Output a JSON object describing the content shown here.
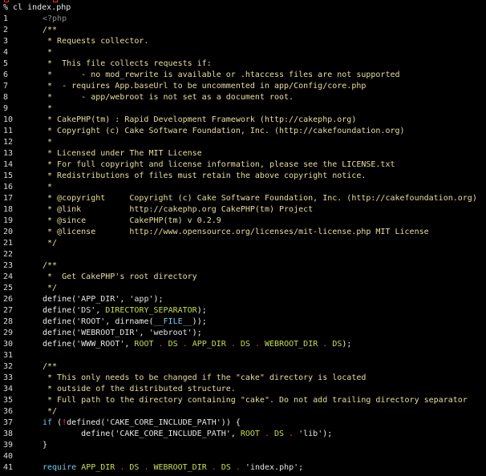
{
  "prompt": "% cl index.php",
  "lines": [
    [
      [
        "t",
        "<?php"
      ]
    ],
    [
      [
        "c",
        "/**"
      ]
    ],
    [
      [
        "c",
        " * Requests collector."
      ]
    ],
    [
      [
        "c",
        " *"
      ]
    ],
    [
      [
        "c",
        " *  This file collects requests if:"
      ]
    ],
    [
      [
        "c",
        " *      - no mod_rewrite is available or .htaccess files are not supported"
      ]
    ],
    [
      [
        "c",
        " *  - requires App.baseUrl to be uncommented in app/Config/core.php"
      ]
    ],
    [
      [
        "c",
        " *      - app/webroot is not set as a document root."
      ]
    ],
    [
      [
        "c",
        " *"
      ]
    ],
    [
      [
        "c",
        " * CakePHP(tm) : Rapid Development Framework (http://cakephp.org)"
      ]
    ],
    [
      [
        "c",
        " * Copyright (c) Cake Software Foundation, Inc. (http://cakefoundation.org)"
      ]
    ],
    [
      [
        "c",
        " *"
      ]
    ],
    [
      [
        "c",
        " * Licensed under The MIT License"
      ]
    ],
    [
      [
        "c",
        " * For full copyright and license information, please see the LICENSE.txt"
      ]
    ],
    [
      [
        "c",
        " * Redistributions of files must retain the above copyright notice."
      ]
    ],
    [
      [
        "c",
        " *"
      ]
    ],
    [
      [
        "c",
        " * @copyright     Copyright (c) Cake Software Foundation, Inc. (http://cakefoundation.org)"
      ]
    ],
    [
      [
        "c",
        " * @link          http://cakephp.org CakePHP(tm) Project"
      ]
    ],
    [
      [
        "c",
        " * @since         CakePHP(tm) v 0.2.9"
      ]
    ],
    [
      [
        "c",
        " * @license       http://www.opensource.org/licenses/mit-license.php MIT License"
      ]
    ],
    [
      [
        "c",
        " */"
      ]
    ],
    [],
    [
      [
        "c",
        "/**"
      ]
    ],
    [
      [
        "c",
        " *  Get CakePHP's root directory"
      ]
    ],
    [
      [
        "c",
        " */"
      ]
    ],
    [
      [
        "f",
        "define("
      ],
      [
        "s",
        "'APP_DIR'"
      ],
      [
        "p",
        ", "
      ],
      [
        "s",
        "'app'"
      ],
      [
        "p",
        ");"
      ]
    ],
    [
      [
        "f",
        "define("
      ],
      [
        "s",
        "'DS'"
      ],
      [
        "p",
        ", "
      ],
      [
        "k",
        "DIRECTORY_SEPARATOR"
      ],
      [
        "p",
        ");"
      ]
    ],
    [
      [
        "f",
        "define("
      ],
      [
        "s",
        "'ROOT'"
      ],
      [
        "p",
        ", dirname("
      ],
      [
        "kw",
        "__FILE__"
      ],
      [
        "p",
        "));"
      ]
    ],
    [
      [
        "f",
        "define("
      ],
      [
        "s",
        "'WEBROOT_DIR'"
      ],
      [
        "p",
        ", "
      ],
      [
        "s",
        "'webroot'"
      ],
      [
        "p",
        ");"
      ]
    ],
    [
      [
        "f",
        "define("
      ],
      [
        "s",
        "'WWW_ROOT'"
      ],
      [
        "p",
        ", "
      ],
      [
        "k",
        "ROOT"
      ],
      [
        "d",
        " . "
      ],
      [
        "k",
        "DS"
      ],
      [
        "d",
        " . "
      ],
      [
        "k",
        "APP_DIR"
      ],
      [
        "d",
        " . "
      ],
      [
        "k",
        "DS"
      ],
      [
        "d",
        " . "
      ],
      [
        "k",
        "WEBROOT_DIR"
      ],
      [
        "d",
        " . "
      ],
      [
        "k",
        "DS"
      ],
      [
        "p",
        ");"
      ]
    ],
    [],
    [
      [
        "c",
        "/**"
      ]
    ],
    [
      [
        "c",
        " * This only needs to be changed if the \"cake\" directory is located"
      ]
    ],
    [
      [
        "c",
        " * outside of the distributed structure."
      ]
    ],
    [
      [
        "c",
        " * Full path to the directory containing \"cake\". Do not add trailing directory separator"
      ]
    ],
    [
      [
        "c",
        " */"
      ]
    ],
    [
      [
        "kw",
        "if"
      ],
      [
        "p",
        " ("
      ],
      [
        "d",
        "!"
      ],
      [
        "f",
        "defined("
      ],
      [
        "s",
        "'CAKE_CORE_INCLUDE_PATH'"
      ],
      [
        "p",
        ")) {"
      ]
    ],
    [
      [
        "f",
        "        define("
      ],
      [
        "s",
        "'CAKE_CORE_INCLUDE_PATH'"
      ],
      [
        "p",
        ", "
      ],
      [
        "k",
        "ROOT"
      ],
      [
        "d",
        " . "
      ],
      [
        "k",
        "DS"
      ],
      [
        "d",
        " . "
      ],
      [
        "s",
        "'lib'"
      ],
      [
        "p",
        ");"
      ]
    ],
    [
      [
        "p",
        "}"
      ]
    ],
    [],
    [
      [
        "kw",
        "require"
      ],
      [
        "p",
        " "
      ],
      [
        "k",
        "APP_DIR"
      ],
      [
        "d",
        " . "
      ],
      [
        "k",
        "DS"
      ],
      [
        "d",
        " . "
      ],
      [
        "k",
        "WEBROOT_DIR"
      ],
      [
        "d",
        " . "
      ],
      [
        "k",
        "DS"
      ],
      [
        "d",
        " . "
      ],
      [
        "s",
        "'index.php'"
      ],
      [
        "p",
        ";"
      ]
    ]
  ],
  "colors": {
    "comment": "#e8dea0",
    "constant": "#c8dc50",
    "operator": "#f03a6a",
    "keyword": "#78c8f0",
    "tag": "#8c8c8c"
  }
}
